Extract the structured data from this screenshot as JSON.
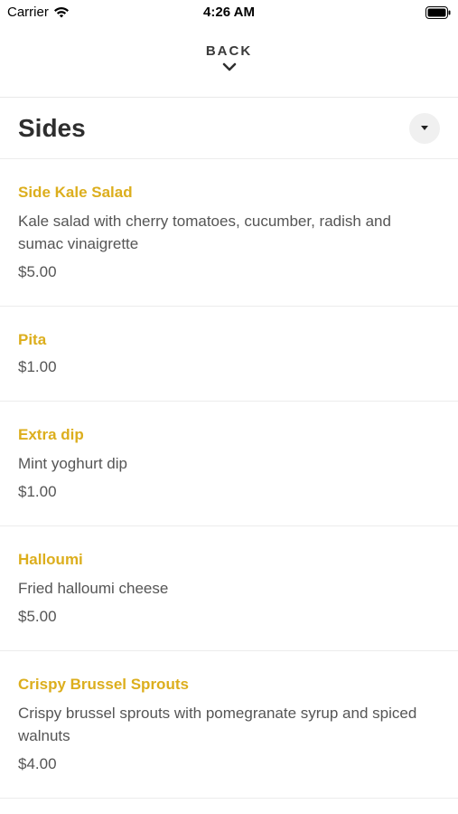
{
  "status_bar": {
    "carrier": "Carrier",
    "time": "4:26 AM"
  },
  "nav": {
    "back_label": "BACK"
  },
  "section": {
    "title": "Sides"
  },
  "items": [
    {
      "name": "Side Kale Salad",
      "description": "Kale salad with cherry tomatoes, cucumber, radish and sumac vinaigrette",
      "price": "$5.00"
    },
    {
      "name": "Pita",
      "description": "",
      "price": "$1.00"
    },
    {
      "name": "Extra dip",
      "description": "Mint yoghurt dip",
      "price": "$1.00"
    },
    {
      "name": "Halloumi",
      "description": "Fried halloumi cheese",
      "price": "$5.00"
    },
    {
      "name": "Crispy Brussel Sprouts",
      "description": "Crispy brussel sprouts with pomegranate syrup and spiced walnuts",
      "price": "$4.00"
    }
  ],
  "colors": {
    "accent": "#dcae1d",
    "text": "#555555",
    "divider": "#ececec"
  }
}
